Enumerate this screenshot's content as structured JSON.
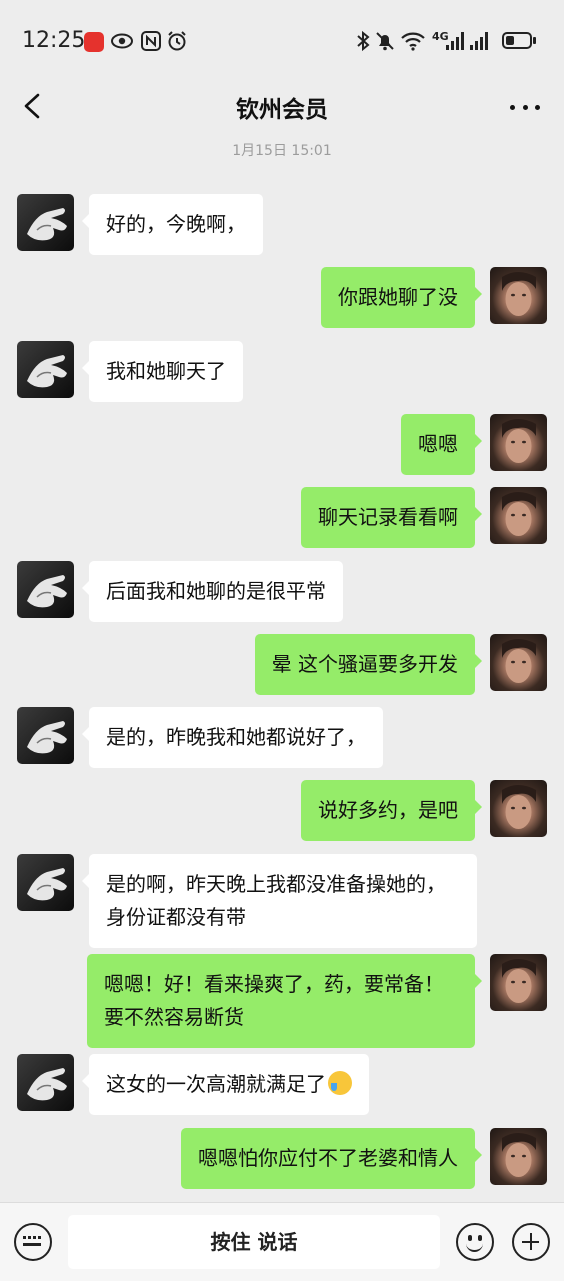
{
  "status_bar": {
    "time": "12:25",
    "network": "4G",
    "icons": [
      "huawei-app-icon",
      "eye-icon",
      "nfc-icon",
      "alarm-icon",
      "bluetooth-icon",
      "mute-icon",
      "wifi-icon",
      "signal-icon",
      "battery-icon"
    ]
  },
  "header": {
    "title": "钦州会员",
    "back_icon": "chevron-left-icon",
    "more_icon": "more-dots-icon"
  },
  "chat": {
    "timestamp": "1月15日 15:01",
    "messages": [
      {
        "from": "contact",
        "text": "好的，今晚啊，"
      },
      {
        "from": "me",
        "text": "你跟她聊了没"
      },
      {
        "from": "contact",
        "text": "我和她聊天了"
      },
      {
        "from": "me",
        "text": "嗯嗯"
      },
      {
        "from": "me",
        "text": "聊天记录看看啊"
      },
      {
        "from": "contact",
        "text": "后面我和她聊的是很平常"
      },
      {
        "from": "me",
        "text": "晕 这个骚逼要多开发"
      },
      {
        "from": "contact",
        "text": "是的，昨晚我和她都说好了，"
      },
      {
        "from": "me",
        "text": "说好多约，是吧"
      },
      {
        "from": "contact",
        "text": "是的啊，昨天晚上我都没准备操她的，身份证都没有带"
      },
      {
        "from": "me",
        "text": "嗯嗯！好！看来操爽了，药，要常备！要不然容易断货"
      },
      {
        "from": "contact",
        "text": "这女的一次高潮就满足了",
        "emoji": "crying-laughing-emoji"
      },
      {
        "from": "me",
        "text": "嗯嗯怕你应付不了老婆和情人"
      }
    ]
  },
  "input_bar": {
    "voice_keyboard_icon": "keyboard-icon",
    "hold_to_talk_label": "按住 说话",
    "emoji_icon": "emoji-icon",
    "plus_icon": "plus-icon"
  },
  "colors": {
    "background": "#ededed",
    "outgoing_bubble": "#95ec69",
    "incoming_bubble": "#ffffff"
  }
}
